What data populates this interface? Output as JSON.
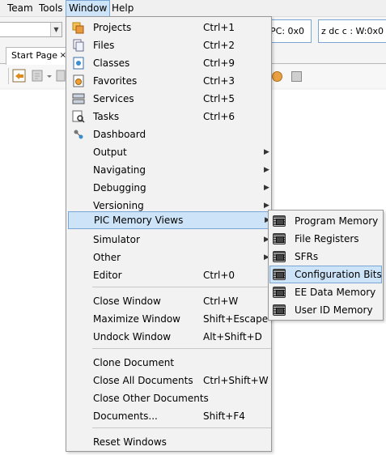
{
  "menubar": {
    "items": [
      "Team",
      "Tools",
      "Window",
      "Help"
    ]
  },
  "status": {
    "pc": "PC: 0x0",
    "w": "z dc c  : W:0x0 :"
  },
  "tabs": {
    "start_page": "Start Page",
    "close": "×"
  },
  "window_menu": {
    "items": [
      {
        "label": "Projects",
        "shortcut": "Ctrl+1",
        "icon": "projects-icon"
      },
      {
        "label": "Files",
        "shortcut": "Ctrl+2",
        "icon": "files-icon"
      },
      {
        "label": "Classes",
        "shortcut": "Ctrl+9",
        "icon": "classes-icon"
      },
      {
        "label": "Favorites",
        "shortcut": "Ctrl+3",
        "icon": "favorites-icon"
      },
      {
        "label": "Services",
        "shortcut": "Ctrl+5",
        "icon": "services-icon"
      },
      {
        "label": "Tasks",
        "shortcut": "Ctrl+6",
        "icon": "tasks-icon"
      },
      {
        "label": "Dashboard",
        "shortcut": "",
        "icon": "dashboard-icon"
      },
      {
        "label": "Output",
        "submenu": true
      },
      {
        "label": "Navigating",
        "submenu": true
      },
      {
        "label": "Debugging",
        "submenu": true
      },
      {
        "label": "Versioning",
        "submenu": true
      },
      {
        "label": "PIC Memory Views",
        "submenu": true,
        "highlighted": true
      },
      {
        "label": "Simulator",
        "submenu": true
      },
      {
        "label": "Other",
        "submenu": true
      },
      {
        "label": "Editor",
        "shortcut": "Ctrl+0"
      },
      {
        "label": "Close Window",
        "shortcut": "Ctrl+W"
      },
      {
        "label": "Maximize Window",
        "shortcut": "Shift+Escape"
      },
      {
        "label": "Undock Window",
        "shortcut": "Alt+Shift+D"
      },
      {
        "label": "Clone Document",
        "shortcut": ""
      },
      {
        "label": "Close All Documents",
        "shortcut": "Ctrl+Shift+W"
      },
      {
        "label": "Close Other Documents",
        "shortcut": ""
      },
      {
        "label": "Documents...",
        "shortcut": "Shift+F4"
      },
      {
        "label": "Reset Windows",
        "shortcut": ""
      }
    ]
  },
  "pic_memory_submenu": {
    "items": [
      {
        "label": "Program Memory"
      },
      {
        "label": "File Registers"
      },
      {
        "label": "SFRs"
      },
      {
        "label": "Configuration Bits",
        "highlighted": true
      },
      {
        "label": "EE Data Memory"
      },
      {
        "label": "User ID Memory"
      }
    ]
  },
  "colors": {
    "highlight_bg": "#cde3f7",
    "highlight_border": "#7aa6d6",
    "menu_bg": "#f2f2f2"
  }
}
